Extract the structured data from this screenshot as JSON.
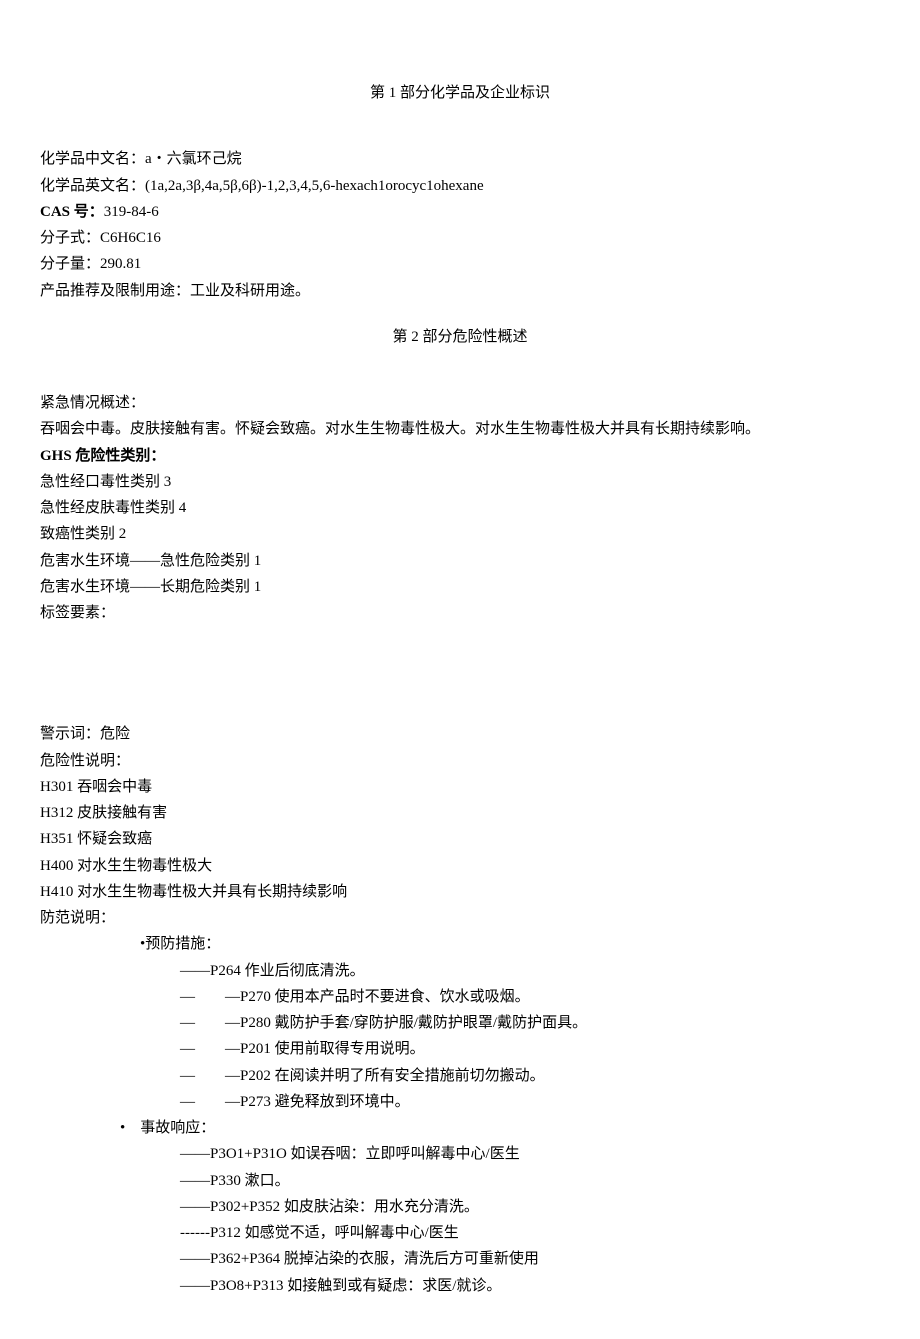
{
  "section1": {
    "title": "第 1 部分化学品及企业标识",
    "cn_name_label": "化学品中文名：",
    "cn_name_value": "a・六氯环己烷",
    "en_name_label": "化学品英文名：",
    "en_name_value": "(1a,2a,3β,4a,5β,6β)-1,2,3,4,5,6-hexach1orocyc1ohexane",
    "cas_label": "CAS 号：",
    "cas_value": "319-84-6",
    "formula_label": "分子式：",
    "formula_value": "C6H6C16",
    "mw_label": "分子量：",
    "mw_value": "290.81",
    "use_label": "产品推荐及限制用途：",
    "use_value": "工业及科研用途。"
  },
  "section2": {
    "title": "第 2 部分危险性概述",
    "emergency_label": "紧急情况概述：",
    "emergency_text": "吞咽会中毒。皮肤接触有害。怀疑会致癌。对水生生物毒性极大。对水生生物毒性极大并具有长期持续影响。",
    "ghs_label": "GHS 危险性类别：",
    "ghs_items": [
      "急性经口毒性类别 3",
      "急性经皮肤毒性类别 4",
      "致癌性类别 2",
      "危害水生环境——急性危险类别 1",
      "危害水生环境——长期危险类别 1"
    ],
    "label_elements": "标签要素：",
    "signal_word_label": "警示词：",
    "signal_word_value": "危险",
    "hazard_label": "危险性说明：",
    "hazard_items": [
      "H301 吞咽会中毒",
      "H312 皮肤接触有害",
      "H351 怀疑会致癌",
      "H400 对水生生物毒性极大",
      "H410 对水生生物毒性极大并具有长期持续影响"
    ],
    "precaution_label": "防范说明：",
    "prevention_header": "•预防措施：",
    "prevention_items": [
      "——P264 作业后彻底清洗。",
      "—　　—P270 使用本产品时不要进食、饮水或吸烟。",
      "—　　—P280 戴防护手套/穿防护服/戴防护眼罩/戴防护面具。",
      "—　　—P201 使用前取得专用说明。",
      "—　　—P202 在阅读并明了所有安全措施前切勿搬动。",
      "—　　—P273 避免释放到环境中。"
    ],
    "response_header": "•　事故响应：",
    "response_items": [
      "——P3O1+P31O 如误吞咽：立即呼叫解毒中心/医生",
      "——P330 漱口。",
      "——P302+P352 如皮肤沾染：用水充分清洗。",
      "------P312 如感觉不适，呼叫解毒中心/医生",
      "——P362+P364 脱掉沾染的衣服，清洗后方可重新使用",
      "——P3O8+P313 如接触到或有疑虑：求医/就诊。"
    ]
  }
}
